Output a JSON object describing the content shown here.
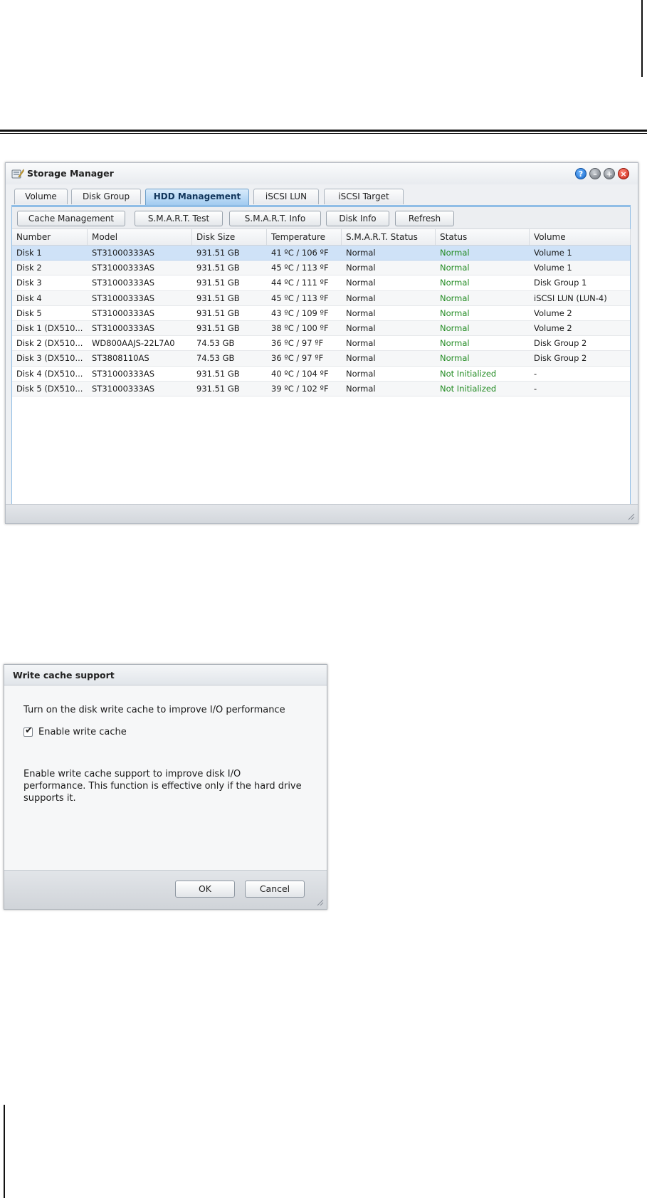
{
  "window": {
    "title": "Storage Manager",
    "tabs": [
      {
        "label": "Volume"
      },
      {
        "label": "Disk Group"
      },
      {
        "label": "HDD Management",
        "active": true
      },
      {
        "label": "iSCSI LUN"
      },
      {
        "label": "iSCSI Target"
      }
    ],
    "toolbar": [
      "Cache Management",
      "S.M.A.R.T. Test",
      "S.M.A.R.T. Info",
      "Disk Info",
      "Refresh"
    ],
    "columns": [
      "Number",
      "Model",
      "Disk Size",
      "Temperature",
      "S.M.A.R.T. Status",
      "Status",
      "Volume"
    ],
    "rows": [
      [
        "Disk 1",
        "ST31000333AS",
        "931.51 GB",
        "41 ºC / 106 ºF",
        "Normal",
        "Normal",
        "Volume 1"
      ],
      [
        "Disk 2",
        "ST31000333AS",
        "931.51 GB",
        "45 ºC / 113 ºF",
        "Normal",
        "Normal",
        "Volume 1"
      ],
      [
        "Disk 3",
        "ST31000333AS",
        "931.51 GB",
        "44 ºC / 111 ºF",
        "Normal",
        "Normal",
        "Disk Group 1"
      ],
      [
        "Disk 4",
        "ST31000333AS",
        "931.51 GB",
        "45 ºC / 113 ºF",
        "Normal",
        "Normal",
        "iSCSI LUN (LUN-4)"
      ],
      [
        "Disk 5",
        "ST31000333AS",
        "931.51 GB",
        "43 ºC / 109 ºF",
        "Normal",
        "Normal",
        "Volume 2"
      ],
      [
        "Disk 1 (DX510...",
        "ST31000333AS",
        "931.51 GB",
        "38 ºC / 100 ºF",
        "Normal",
        "Normal",
        "Volume 2"
      ],
      [
        "Disk 2 (DX510...",
        "WD800AAJS-22L7A0",
        "74.53 GB",
        "36 ºC / 97 ºF",
        "Normal",
        "Normal",
        "Disk Group 2"
      ],
      [
        "Disk 3 (DX510...",
        "ST3808110AS",
        "74.53 GB",
        "36 ºC / 97 ºF",
        "Normal",
        "Normal",
        "Disk Group 2"
      ],
      [
        "Disk 4 (DX510...",
        "ST31000333AS",
        "931.51 GB",
        "40 ºC / 104 ºF",
        "Normal",
        "Not Initialized",
        "-"
      ],
      [
        "Disk 5 (DX510...",
        "ST31000333AS",
        "931.51 GB",
        "39 ºC / 102 ºF",
        "Normal",
        "Not Initialized",
        "-"
      ]
    ],
    "selected_row": 0,
    "status_color": "#228b22",
    "accent": "#8fbde6"
  },
  "dialog": {
    "title": "Write cache support",
    "intro": "Turn on the disk write cache to improve I/O performance",
    "checkbox_label": "Enable write cache",
    "checkbox_checked": true,
    "description_lines": [
      "Enable write cache support to improve disk I/O",
      "performance. This function is effective only if the hard drive",
      "supports it."
    ],
    "ok_label": "OK",
    "cancel_label": "Cancel"
  }
}
